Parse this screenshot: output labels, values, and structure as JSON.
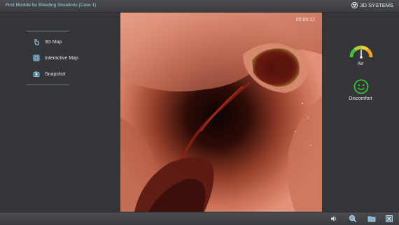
{
  "window": {
    "title": "First Module for Bleeding Situations (Case 1)",
    "brand": "3D SYSTEMS"
  },
  "sidebar": {
    "items": [
      {
        "label": "3D Map",
        "icon": "stomach-map-icon"
      },
      {
        "label": "Interactive Map",
        "icon": "interactive-map-icon"
      },
      {
        "label": "Snapshot",
        "icon": "camera-icon"
      }
    ]
  },
  "viewport": {
    "timer": "00:00:12"
  },
  "status": {
    "air_label": "Air",
    "air_level": 0.5,
    "discomfort_label": "Discomfort",
    "discomfort_state": "happy"
  },
  "toolbar": {
    "tools": [
      {
        "icon": "volume-icon"
      },
      {
        "icon": "search-icon"
      },
      {
        "icon": "folder-icon"
      },
      {
        "icon": "exit-icon"
      }
    ]
  },
  "colors": {
    "title_text": "#9fd7ee",
    "panel_bg": "#333538",
    "face_green": "#3fbf3a",
    "tissue": "#c4654c"
  }
}
